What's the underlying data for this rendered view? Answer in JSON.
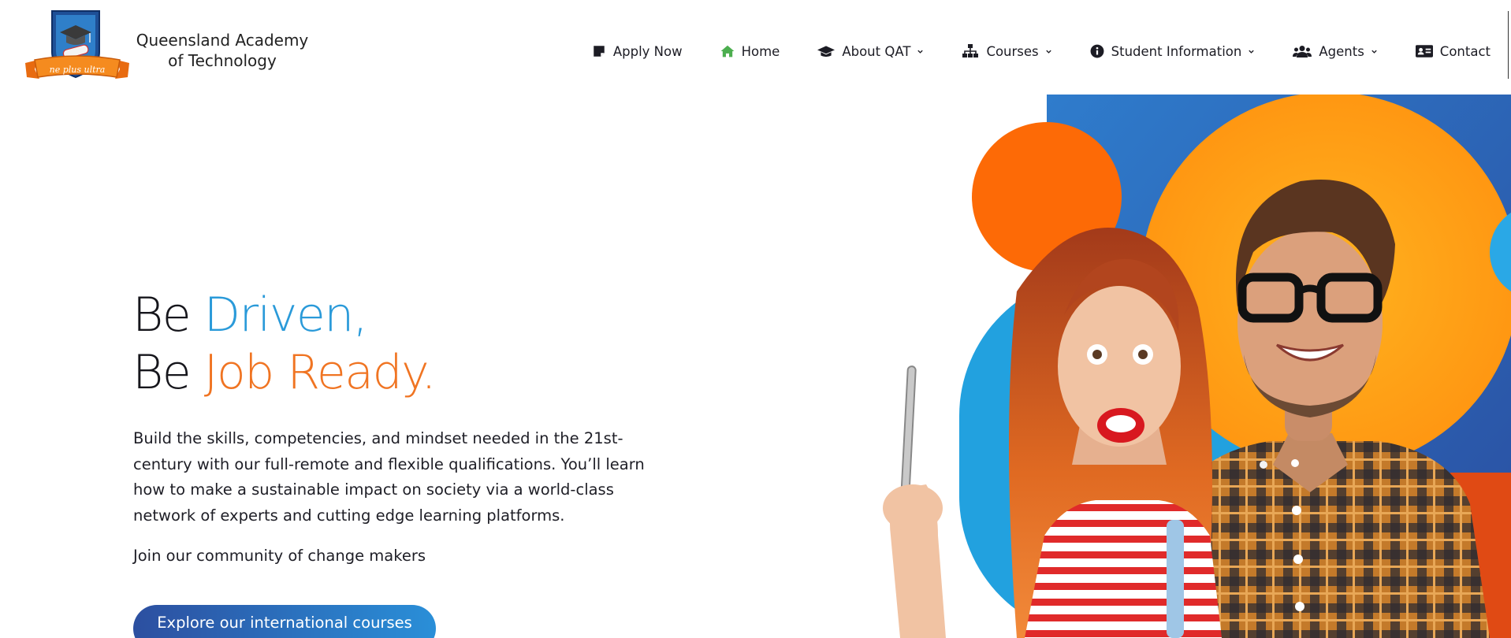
{
  "brand": {
    "name_line1": "Queensland Academy",
    "name_line2": "of Technology",
    "motto": "ne plus ultra"
  },
  "nav": {
    "items": [
      {
        "label": "Apply Now",
        "icon": "form-icon",
        "dropdown": false
      },
      {
        "label": "Home",
        "icon": "home-icon",
        "dropdown": false
      },
      {
        "label": "About QAT",
        "icon": "graduation-cap-icon",
        "dropdown": true
      },
      {
        "label": "Courses",
        "icon": "sitemap-icon",
        "dropdown": true
      },
      {
        "label": "Student Information",
        "icon": "info-circle-icon",
        "dropdown": true
      },
      {
        "label": "Agents",
        "icon": "users-icon",
        "dropdown": true
      },
      {
        "label": "Contact",
        "icon": "contact-card-icon",
        "dropdown": false
      }
    ]
  },
  "hero": {
    "line1_prefix": "Be ",
    "line1_accent": "Driven,",
    "line2_prefix": "Be ",
    "line2_accent": "Job Ready.",
    "body": "Build the skills, competencies, and mindset needed in the 21st-century with our full-remote and flexible qualifications. You’ll learn how to make a sustainable impact on society via a world-class network of experts and cutting edge learning platforms.",
    "sub": "Join our community of change makers",
    "cta_label": "Explore our international courses"
  },
  "colors": {
    "accent_blue": "#2a9ad9",
    "accent_orange": "#f07422",
    "home_icon_green": "#4cae4f",
    "navy": "#2c4fa0"
  }
}
